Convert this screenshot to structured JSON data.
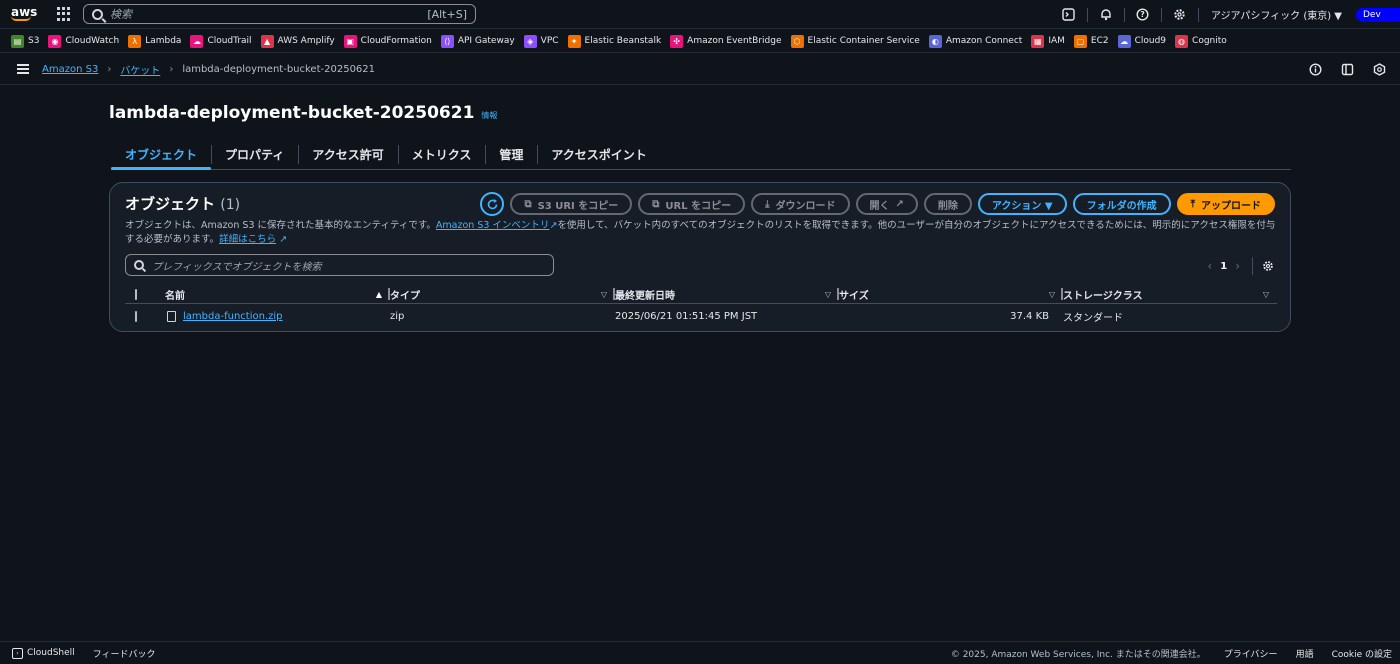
{
  "topbar": {
    "logo": "aws",
    "search_placeholder": "検索",
    "search_shortcut": "[Alt+S]",
    "region": "アジアパシフィック (東京) ▼",
    "account_badge": "Dev"
  },
  "favorites": [
    {
      "label": "S3",
      "color": "#3f8624",
      "glyph": "▤"
    },
    {
      "label": "CloudWatch",
      "color": "#e7157b",
      "glyph": "◉"
    },
    {
      "label": "Lambda",
      "color": "#ed7100",
      "glyph": "λ"
    },
    {
      "label": "CloudTrail",
      "color": "#e7157b",
      "glyph": "☁"
    },
    {
      "label": "AWS Amplify",
      "color": "#dd344c",
      "glyph": "▲"
    },
    {
      "label": "CloudFormation",
      "color": "#e7157b",
      "glyph": "▣"
    },
    {
      "label": "API Gateway",
      "color": "#8c4fff",
      "glyph": "⟨⟩"
    },
    {
      "label": "VPC",
      "color": "#8c4fff",
      "glyph": "◈"
    },
    {
      "label": "Elastic Beanstalk",
      "color": "#ed7100",
      "glyph": "✦"
    },
    {
      "label": "Amazon EventBridge",
      "color": "#e7157b",
      "glyph": "✣"
    },
    {
      "label": "Elastic Container Service",
      "color": "#ed7100",
      "glyph": "⬡"
    },
    {
      "label": "Amazon Connect",
      "color": "#5a65d8",
      "glyph": "◐"
    },
    {
      "label": "IAM",
      "color": "#dd344c",
      "glyph": "▦"
    },
    {
      "label": "EC2",
      "color": "#ed7100",
      "glyph": "▢"
    },
    {
      "label": "Cloud9",
      "color": "#5a65d8",
      "glyph": "☁"
    },
    {
      "label": "Cognito",
      "color": "#dd344c",
      "glyph": "◍"
    }
  ],
  "breadcrumb": {
    "items": [
      "Amazon S3",
      "バケット"
    ],
    "current": "lambda-deployment-bucket-20250621"
  },
  "page": {
    "title": "lambda-deployment-bucket-20250621",
    "info": "情報"
  },
  "tabs": [
    {
      "label": "オブジェクト",
      "active": true
    },
    {
      "label": "プロパティ"
    },
    {
      "label": "アクセス許可"
    },
    {
      "label": "メトリクス"
    },
    {
      "label": "管理"
    },
    {
      "label": "アクセスポイント"
    }
  ],
  "objects_panel": {
    "title": "オブジェクト",
    "count": "(1)",
    "buttons": {
      "copy_s3_uri": "S3 URI をコピー",
      "copy_url": "URL をコピー",
      "download": "ダウンロード",
      "open": "開く",
      "delete": "削除",
      "actions": "アクション ▼",
      "create_folder": "フォルダの作成",
      "upload": "アップロード"
    },
    "description": {
      "part1": "オブジェクトは、Amazon S3 に保存された基本的なエンティティです。",
      "link1": "Amazon S3 インベントリ",
      "part2": "を使用して、バケット内のすべてのオブジェクトのリストを取得できます。他のユーザーが自分のオブジェクトにアクセスできるためには、明示的にアクセス権限を付与する必要があります。",
      "link2": "詳細はこちら"
    },
    "search_placeholder": "プレフィックスでオブジェクトを検索",
    "page_number": "1",
    "columns": [
      "名前",
      "タイプ",
      "最終更新日時",
      "サイズ",
      "ストレージクラス"
    ],
    "rows": [
      {
        "name": "lambda-function.zip",
        "type": "zip",
        "modified": "2025/06/21 01:51:45 PM JST",
        "size": "37.4 KB",
        "storage_class": "スタンダード"
      }
    ]
  },
  "footer": {
    "cloudshell": "CloudShell",
    "feedback": "フィードバック",
    "copyright": "© 2025, Amazon Web Services, Inc. またはその関連会社。",
    "privacy": "プライバシー",
    "terms": "用語",
    "cookie": "Cookie の設定"
  }
}
